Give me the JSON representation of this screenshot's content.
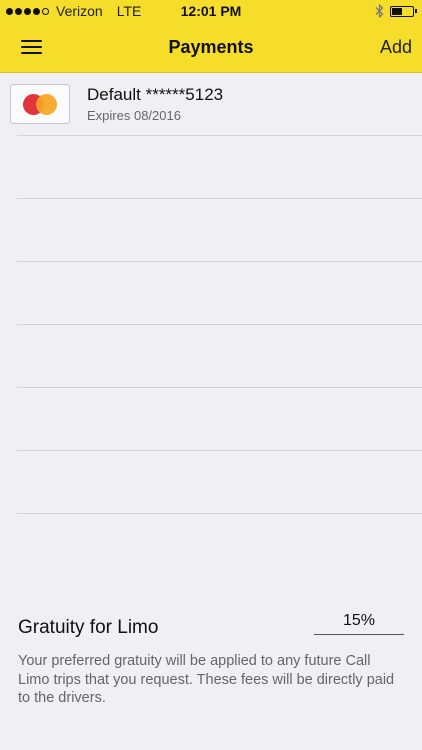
{
  "status_bar": {
    "carrier": "Verizon",
    "network": "LTE",
    "time": "12:01 PM",
    "signal_strength_of_5": 4,
    "battery_level": 0.55,
    "icons": [
      "signal-dots-icon",
      "bluetooth-icon",
      "battery-icon"
    ]
  },
  "nav": {
    "title": "Payments",
    "add_label": "Add",
    "menu_icon": "hamburger-menu-icon",
    "background_color": "#f5dd2a"
  },
  "cards": [
    {
      "title": "Default ******5123",
      "expiry": "Expires 08/2016",
      "brand_icon": "mastercard-icon"
    }
  ],
  "gratuity": {
    "label": "Gratuity for Limo",
    "value": "15%",
    "description": "Your preferred gratuity will be applied to any future Call Limo trips that you request. These fees will be directly paid to the drivers."
  },
  "colors": {
    "accent": "#f5dd2a",
    "background": "#efeff4",
    "mastercard_red": "#e2343c",
    "mastercard_orange": "#f6a623"
  }
}
